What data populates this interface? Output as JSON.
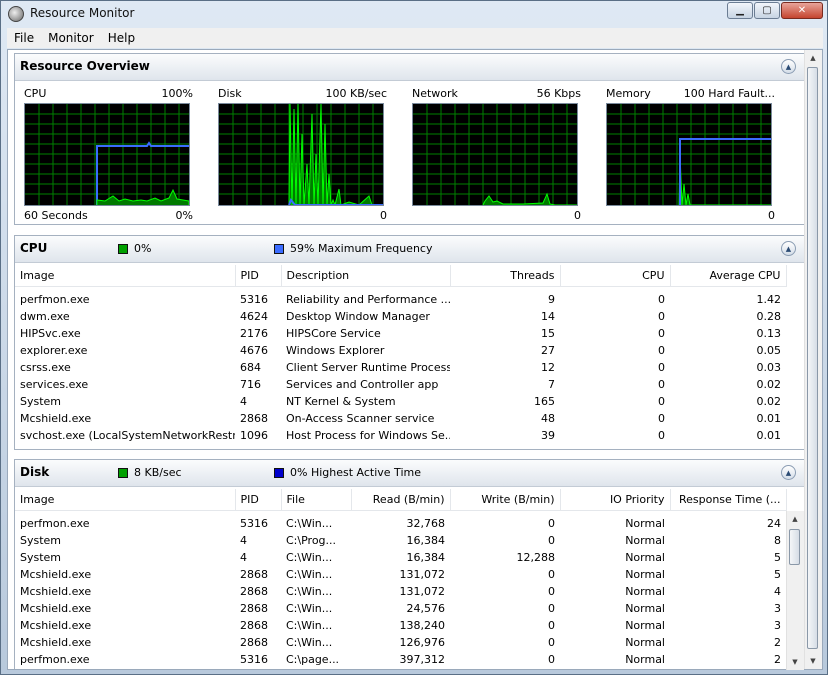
{
  "window": {
    "title": "Resource Monitor",
    "min_glyph": "▁",
    "max_glyph": "▢",
    "close_glyph": "✕"
  },
  "menu": [
    "File",
    "Monitor",
    "Help"
  ],
  "overview": {
    "title": "Resource Overview",
    "collapse_glyph": "▲",
    "graphs": [
      {
        "name": "CPU",
        "max": "100%",
        "foot_left": "60 Seconds",
        "foot_right": "0%"
      },
      {
        "name": "Disk",
        "max": "100 KB/sec",
        "foot_left": "",
        "foot_right": "0"
      },
      {
        "name": "Network",
        "max": "56 Kbps",
        "foot_left": "",
        "foot_right": "0"
      },
      {
        "name": "Memory",
        "max": "100 Hard Fault...",
        "foot_left": "",
        "foot_right": "0"
      }
    ]
  },
  "cpu": {
    "title": "CPU",
    "legend1": "0%",
    "legend2": "59% Maximum Frequency",
    "columns": [
      "Image",
      "PID",
      "Description",
      "Threads",
      "CPU",
      "Average CPU"
    ],
    "rows": [
      [
        "perfmon.exe",
        "5316",
        "Reliability and Performance ...",
        "9",
        "0",
        "1.42"
      ],
      [
        "dwm.exe",
        "4624",
        "Desktop Window Manager",
        "14",
        "0",
        "0.28"
      ],
      [
        "HIPSvc.exe",
        "2176",
        "HIPSCore Service",
        "15",
        "0",
        "0.13"
      ],
      [
        "explorer.exe",
        "4676",
        "Windows Explorer",
        "27",
        "0",
        "0.05"
      ],
      [
        "csrss.exe",
        "684",
        "Client Server Runtime Process",
        "12",
        "0",
        "0.03"
      ],
      [
        "services.exe",
        "716",
        "Services and Controller app",
        "7",
        "0",
        "0.02"
      ],
      [
        "System",
        "4",
        "NT Kernel & System",
        "165",
        "0",
        "0.02"
      ],
      [
        "Mcshield.exe",
        "2868",
        "On-Access Scanner service",
        "48",
        "0",
        "0.01"
      ],
      [
        "svchost.exe (LocalSystemNetworkRestric...",
        "1096",
        "Host Process for Windows Se...",
        "39",
        "0",
        "0.01"
      ]
    ]
  },
  "disk": {
    "title": "Disk",
    "legend1": "8 KB/sec",
    "legend2": "0% Highest Active Time",
    "columns": [
      "Image",
      "PID",
      "File",
      "Read (B/min)",
      "Write (B/min)",
      "IO Priority",
      "Response Time (..."
    ],
    "rows": [
      [
        "perfmon.exe",
        "5316",
        "C:\\Win...",
        "32,768",
        "0",
        "Normal",
        "24"
      ],
      [
        "System",
        "4",
        "C:\\Prog...",
        "16,384",
        "0",
        "Normal",
        "8"
      ],
      [
        "System",
        "4",
        "C:\\Win...",
        "16,384",
        "12,288",
        "Normal",
        "5"
      ],
      [
        "Mcshield.exe",
        "2868",
        "C:\\Win...",
        "131,072",
        "0",
        "Normal",
        "5"
      ],
      [
        "Mcshield.exe",
        "2868",
        "C:\\Win...",
        "131,072",
        "0",
        "Normal",
        "4"
      ],
      [
        "Mcshield.exe",
        "2868",
        "C:\\Win...",
        "24,576",
        "0",
        "Normal",
        "3"
      ],
      [
        "Mcshield.exe",
        "2868",
        "C:\\Win...",
        "138,240",
        "0",
        "Normal",
        "3"
      ],
      [
        "Mcshield.exe",
        "2868",
        "C:\\Win...",
        "126,976",
        "0",
        "Normal",
        "2"
      ],
      [
        "perfmon.exe",
        "5316",
        "C:\\page...",
        "397,312",
        "0",
        "Normal",
        "2"
      ]
    ]
  },
  "colors": {
    "graph_green": "#00ff00",
    "graph_blue": "#3b6cff",
    "grid": "#008000",
    "legend_green": "#00a000",
    "legend_blue": "#0000cc"
  }
}
